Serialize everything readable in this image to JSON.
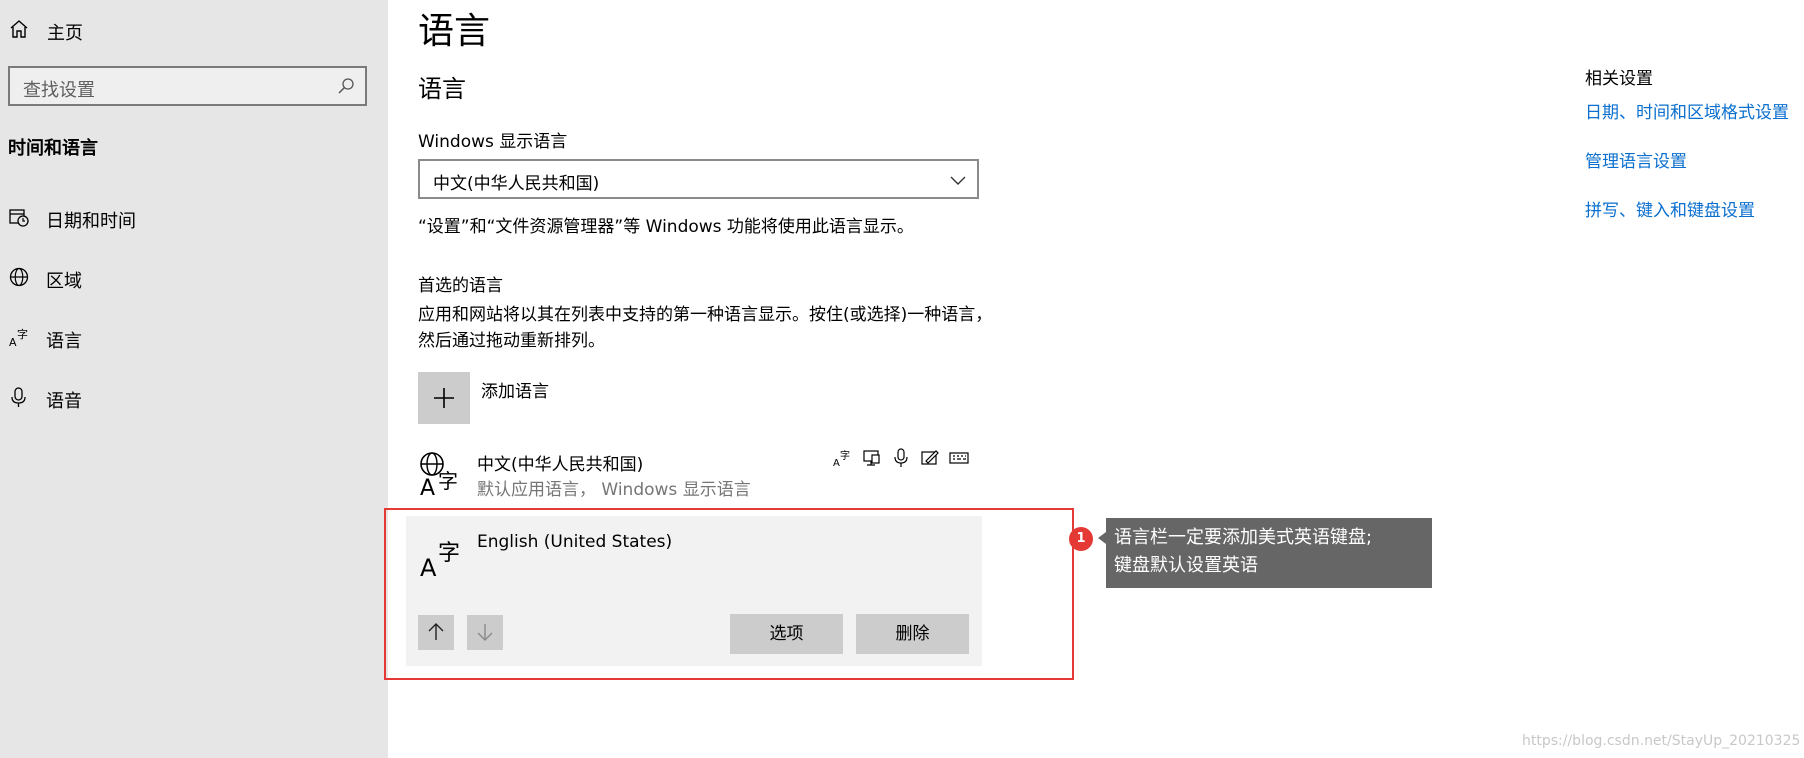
{
  "sidebar": {
    "home_label": "主页",
    "search_placeholder": "查找设置",
    "section_title": "时间和语言",
    "items": [
      {
        "label": "日期和时间",
        "icon": "calendar-clock-icon"
      },
      {
        "label": "区域",
        "icon": "globe-icon"
      },
      {
        "label": "语言",
        "icon": "language-icon"
      },
      {
        "label": "语音",
        "icon": "microphone-icon"
      }
    ]
  },
  "main": {
    "page_title": "语言",
    "section_title": "语言",
    "display_language_label": "Windows 显示语言",
    "display_language_value": "中文(中华人民共和国)",
    "display_note": "“设置”和“文件资源管理器”等 Windows 功能将使用此语言显示。",
    "preferred_title": "首选的语言",
    "preferred_desc": "应用和网站将以其在列表中支持的第一种语言显示。按住(或选择)一种语言，然后通过拖动重新排列。",
    "add_language_label": "添加语言",
    "languages": [
      {
        "name": "中文(中华人民共和国)",
        "sub": "默认应用语言， Windows 显示语言"
      },
      {
        "name": "English (United States)"
      }
    ],
    "options_button": "选项",
    "remove_button": "删除"
  },
  "annotation": {
    "badge": "1",
    "text_line1": "语言栏一定要添加美式英语键盘;",
    "text_line2": "键盘默认设置英语",
    "highlight_color": "#e53935"
  },
  "related": {
    "title": "相关设置",
    "links": [
      "日期、时间和区域格式设置",
      "管理语言设置",
      "拼写、键入和键盘设置"
    ],
    "link_color": "#0a6fce"
  },
  "watermark": "https://blog.csdn.net/StayUp_20210325"
}
